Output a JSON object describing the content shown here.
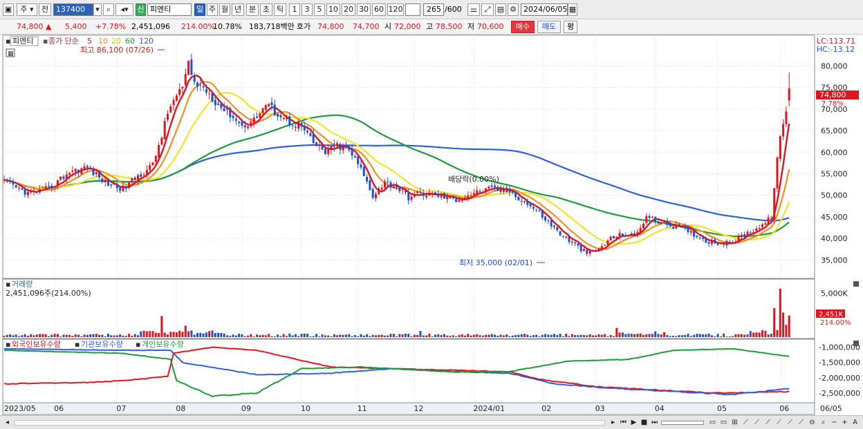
{
  "toolbar": {
    "market": "주",
    "prev": "전",
    "code": "137400",
    "badge": "신",
    "stock_name": "피엔티",
    "periods": [
      "일",
      "주",
      "월",
      "년",
      "분",
      "초",
      "틱"
    ],
    "intervals": [
      "1",
      "3",
      "5",
      "10",
      "20",
      "30",
      "60",
      "120"
    ],
    "count": "265",
    "count_total": "/600",
    "date": "2024/06/05"
  },
  "quote": {
    "price": "74,800",
    "change": "5,400",
    "change_pct": "+7.78%",
    "volume": "2,451,096",
    "vol_ratio": "214.00%",
    "turnover": "10.78%",
    "amount": "183,718백만",
    "bid_label": "호가",
    "ask": "74,800",
    "bid": "74,700",
    "open_label": "시",
    "open": "72,000",
    "high_label": "고",
    "high": "78,500",
    "low_label": "저",
    "low": "70,600",
    "buy_label": "매수",
    "sell_label": "매도",
    "avg_label": "평"
  },
  "price_panel": {
    "name_tag": "피엔티",
    "ma_label": "종가 단순",
    "ma_periods": [
      "5",
      "10",
      "20",
      "60",
      "120"
    ],
    "high_note": "최고 86,100 (07/26)",
    "low_note": "최저 35,000 (02/01)",
    "dividend_note": "배당락(0.00%)",
    "lc": "LC:113.71",
    "hc": "HC:-13.12",
    "last_tag": "74,800",
    "last_pct": "7.78%"
  },
  "volume_panel": {
    "title": "거래량",
    "value": "2,451,096주(214.00%)",
    "last_tag": "2,451K",
    "last_pct": "214.00%",
    "axis": [
      "5,000K"
    ]
  },
  "holding_panel": {
    "foreign": "외국인보유수량",
    "institution": "기관보유수량",
    "individual": "개인보유수량"
  },
  "colors": {
    "up": "#e0141e",
    "down": "#1a4fd6",
    "ma5": "#e0141e",
    "ma10": "#f0901e",
    "ma20": "#f2e426",
    "ma60": "#1f9a3a",
    "ma120": "#2f5fd8"
  },
  "chart_data": {
    "type": "candlestick",
    "price_axis": [
      "80,000",
      "75,000",
      "70,000",
      "65,000",
      "60,000",
      "55,000",
      "50,000",
      "45,000",
      "40,000",
      "35,000"
    ],
    "price_range": [
      32000,
      86000
    ],
    "months": [
      "2023/05",
      "06",
      "07",
      "08",
      "09",
      "10",
      "11",
      "12",
      "2024/01",
      "02",
      "03",
      "04",
      "05",
      "06",
      "06/05"
    ],
    "close_key": [
      [
        0,
        53000
      ],
      [
        8,
        50500
      ],
      [
        15,
        51500
      ],
      [
        22,
        55500
      ],
      [
        28,
        56500
      ],
      [
        34,
        53000
      ],
      [
        40,
        51500
      ],
      [
        46,
        55000
      ],
      [
        50,
        57000
      ],
      [
        56,
        71000
      ],
      [
        60,
        75000
      ],
      [
        62,
        80000
      ],
      [
        64,
        76000
      ],
      [
        68,
        74500
      ],
      [
        72,
        71000
      ],
      [
        76,
        69000
      ],
      [
        80,
        66000
      ],
      [
        84,
        67500
      ],
      [
        88,
        71000
      ],
      [
        92,
        69000
      ],
      [
        96,
        67000
      ],
      [
        100,
        66000
      ],
      [
        104,
        62000
      ],
      [
        108,
        60000
      ],
      [
        112,
        61500
      ],
      [
        116,
        60500
      ],
      [
        120,
        56000
      ],
      [
        124,
        50000
      ],
      [
        128,
        53000
      ],
      [
        132,
        52000
      ],
      [
        136,
        49500
      ],
      [
        140,
        50500
      ],
      [
        146,
        50000
      ],
      [
        152,
        49000
      ],
      [
        158,
        50500
      ],
      [
        164,
        51500
      ],
      [
        170,
        51000
      ],
      [
        175,
        48500
      ],
      [
        180,
        46000
      ],
      [
        184,
        43000
      ],
      [
        188,
        40500
      ],
      [
        192,
        38500
      ],
      [
        196,
        36500
      ],
      [
        200,
        37500
      ],
      [
        204,
        40000
      ],
      [
        208,
        41000
      ],
      [
        212,
        40500
      ],
      [
        216,
        45000
      ],
      [
        220,
        44000
      ],
      [
        224,
        43000
      ],
      [
        228,
        42500
      ],
      [
        232,
        41000
      ],
      [
        236,
        39500
      ],
      [
        240,
        39000
      ],
      [
        244,
        38800
      ],
      [
        248,
        40500
      ],
      [
        252,
        42000
      ],
      [
        256,
        43500
      ],
      [
        258,
        45000
      ],
      [
        259,
        52000
      ],
      [
        260,
        58000
      ],
      [
        261,
        63000
      ],
      [
        262,
        67000
      ],
      [
        263,
        69400
      ],
      [
        264,
        74800
      ]
    ],
    "ma_periods": [
      5,
      10,
      20,
      60,
      120
    ],
    "volume_axis": [
      "5,000K"
    ],
    "volume_spikes": [
      [
        53,
        2400
      ],
      [
        61,
        1300
      ],
      [
        140,
        700
      ],
      [
        206,
        1050
      ],
      [
        219,
        650
      ],
      [
        259,
        3300
      ],
      [
        261,
        5500
      ],
      [
        262,
        2800
      ],
      [
        263,
        1400
      ],
      [
        264,
        2451
      ]
    ],
    "holding_axis": [
      "-1,000,000",
      "-1,500,000",
      "-2,000,000",
      "-2,500,000"
    ],
    "holding_range": [
      -2750000,
      -850000
    ],
    "foreign_key": [
      [
        0,
        -2200000
      ],
      [
        30,
        -2150000
      ],
      [
        45,
        -2050000
      ],
      [
        55,
        -1950000
      ],
      [
        57,
        -1200000
      ],
      [
        70,
        -1000000
      ],
      [
        85,
        -1100000
      ],
      [
        110,
        -1650000
      ],
      [
        130,
        -1700000
      ],
      [
        150,
        -1750000
      ],
      [
        170,
        -1800000
      ],
      [
        180,
        -2050000
      ],
      [
        200,
        -2300000
      ],
      [
        220,
        -2400000
      ],
      [
        240,
        -2500000
      ],
      [
        264,
        -2450000
      ]
    ],
    "institution_key": [
      [
        0,
        -1050000
      ],
      [
        40,
        -1100000
      ],
      [
        56,
        -1100000
      ],
      [
        60,
        -1500000
      ],
      [
        85,
        -1900000
      ],
      [
        110,
        -1850000
      ],
      [
        130,
        -1700000
      ],
      [
        150,
        -1800000
      ],
      [
        170,
        -1850000
      ],
      [
        185,
        -2200000
      ],
      [
        205,
        -2350000
      ],
      [
        225,
        -2450000
      ],
      [
        245,
        -2550000
      ],
      [
        264,
        -2350000
      ]
    ],
    "individual_key": [
      [
        0,
        -1100000
      ],
      [
        40,
        -1200000
      ],
      [
        56,
        -1400000
      ],
      [
        58,
        -2100000
      ],
      [
        70,
        -2600000
      ],
      [
        85,
        -2500000
      ],
      [
        100,
        -1700000
      ],
      [
        120,
        -1650000
      ],
      [
        150,
        -1800000
      ],
      [
        170,
        -1800000
      ],
      [
        190,
        -1450000
      ],
      [
        210,
        -1400000
      ],
      [
        225,
        -1100000
      ],
      [
        245,
        -1050000
      ],
      [
        264,
        -1300000
      ]
    ]
  }
}
